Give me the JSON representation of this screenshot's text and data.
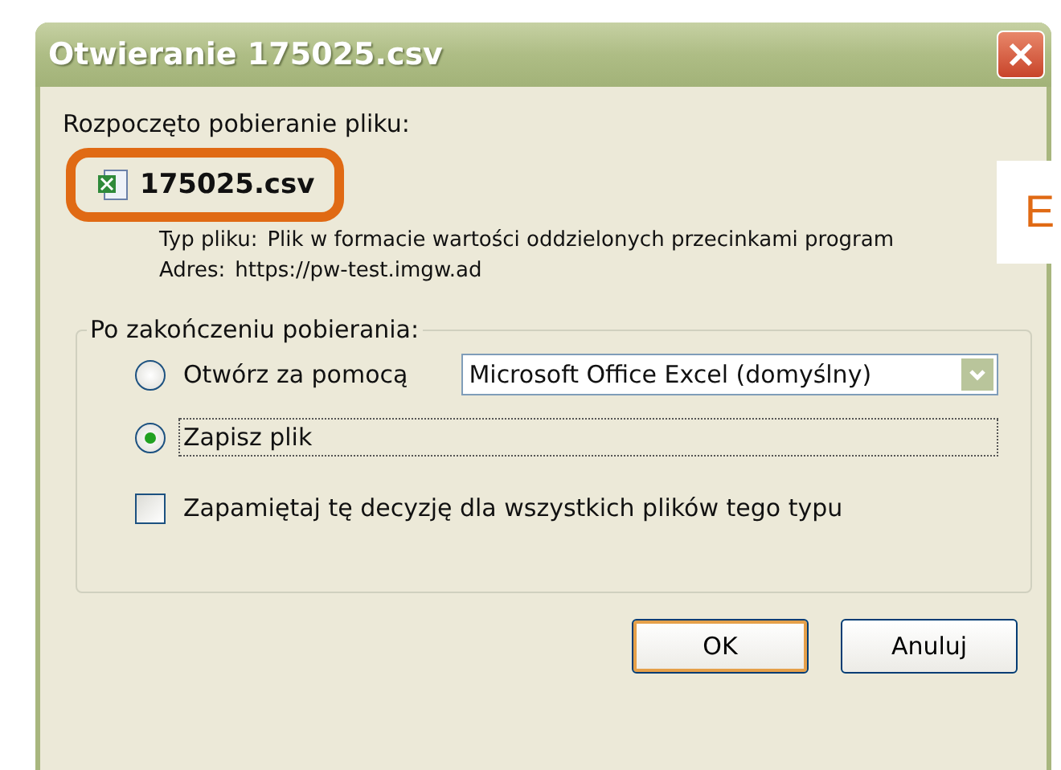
{
  "window": {
    "title": "Otwieranie 175025.csv"
  },
  "intro": "Rozpoczęto pobieranie pliku:",
  "file": {
    "name": "175025.csv",
    "type_label": "Typ pliku:",
    "type_value": "Plik w formacie wartości oddzielonych przecinkami program",
    "address_label": "Adres:",
    "address_value": "https://pw-test.imgw.ad"
  },
  "side_label": "E",
  "group": {
    "title": "Po zakończeniu pobierania:",
    "options": [
      {
        "kind": "radio",
        "label": "Otwórz za pomocą",
        "selected": false,
        "app": "Microsoft Office Excel (domyślny)"
      },
      {
        "kind": "radio",
        "label": "Zapisz plik",
        "selected": true
      },
      {
        "kind": "checkbox",
        "label": "Zapamiętaj tę decyzję dla wszystkich plików tego typu",
        "checked": false
      }
    ]
  },
  "buttons": [
    {
      "label": "OK",
      "default": true
    },
    {
      "label": "Anuluj",
      "default": false
    }
  ]
}
